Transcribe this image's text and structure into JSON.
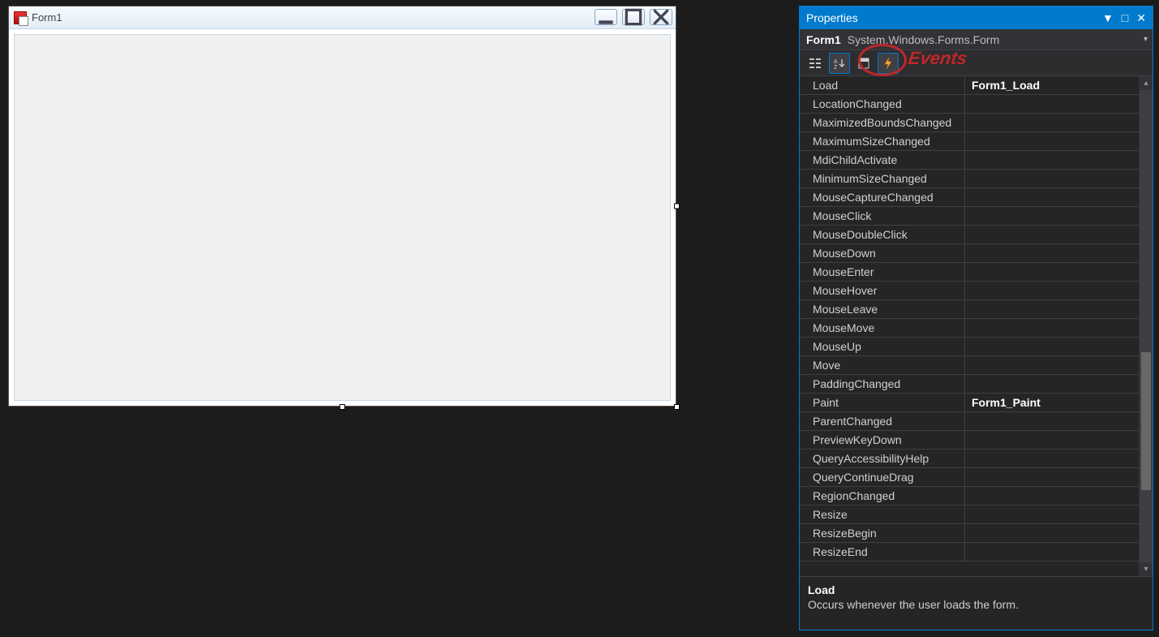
{
  "designer": {
    "form_title": "Form1"
  },
  "panel": {
    "title": "Properties",
    "object_name": "Form1",
    "object_type": "System.Windows.Forms.Form",
    "annotation_label": "Events",
    "events": [
      {
        "name": "Load",
        "value": "Form1_Load"
      },
      {
        "name": "LocationChanged",
        "value": ""
      },
      {
        "name": "MaximizedBoundsChanged",
        "value": ""
      },
      {
        "name": "MaximumSizeChanged",
        "value": ""
      },
      {
        "name": "MdiChildActivate",
        "value": ""
      },
      {
        "name": "MinimumSizeChanged",
        "value": ""
      },
      {
        "name": "MouseCaptureChanged",
        "value": ""
      },
      {
        "name": "MouseClick",
        "value": ""
      },
      {
        "name": "MouseDoubleClick",
        "value": ""
      },
      {
        "name": "MouseDown",
        "value": ""
      },
      {
        "name": "MouseEnter",
        "value": ""
      },
      {
        "name": "MouseHover",
        "value": ""
      },
      {
        "name": "MouseLeave",
        "value": ""
      },
      {
        "name": "MouseMove",
        "value": ""
      },
      {
        "name": "MouseUp",
        "value": ""
      },
      {
        "name": "Move",
        "value": ""
      },
      {
        "name": "PaddingChanged",
        "value": ""
      },
      {
        "name": "Paint",
        "value": "Form1_Paint"
      },
      {
        "name": "ParentChanged",
        "value": ""
      },
      {
        "name": "PreviewKeyDown",
        "value": ""
      },
      {
        "name": "QueryAccessibilityHelp",
        "value": ""
      },
      {
        "name": "QueryContinueDrag",
        "value": ""
      },
      {
        "name": "RegionChanged",
        "value": ""
      },
      {
        "name": "Resize",
        "value": ""
      },
      {
        "name": "ResizeBegin",
        "value": ""
      },
      {
        "name": "ResizeEnd",
        "value": ""
      }
    ],
    "description": {
      "name": "Load",
      "text": "Occurs whenever the user loads the form."
    }
  }
}
